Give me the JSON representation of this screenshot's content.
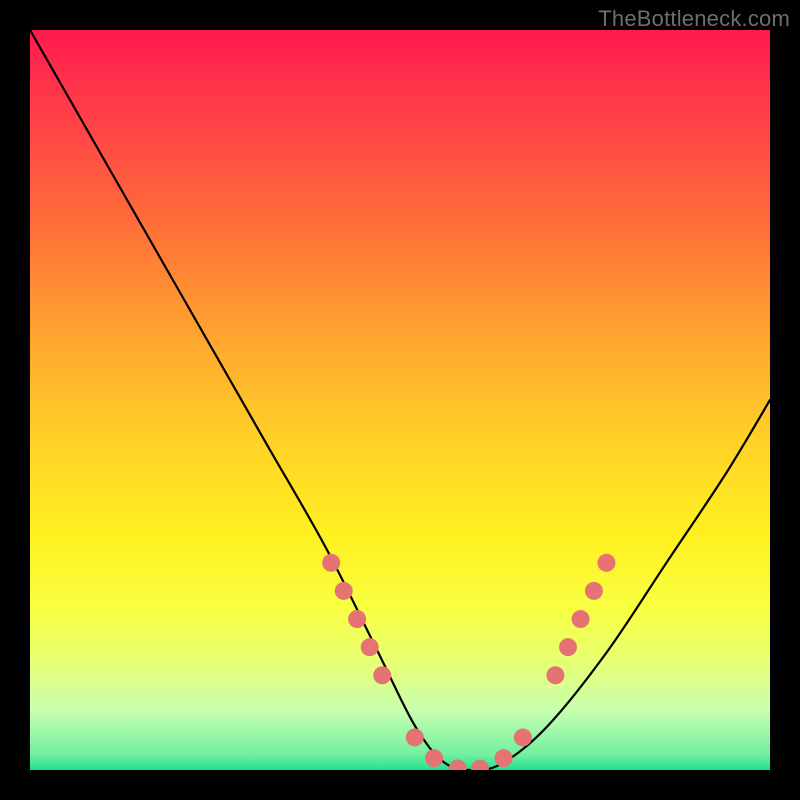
{
  "watermark": "TheBottleneck.com",
  "chart_data": {
    "type": "line",
    "title": "",
    "xlabel": "",
    "ylabel": "",
    "xlim": [
      0,
      100
    ],
    "ylim": [
      0,
      100
    ],
    "grid": false,
    "series": [
      {
        "name": "bottleneck-curve",
        "x": [
          0,
          8,
          16,
          24,
          32,
          40,
          47,
          52,
          56,
          60,
          64,
          70,
          78,
          86,
          94,
          100
        ],
        "values": [
          100,
          86,
          72,
          58,
          44,
          30,
          16,
          6,
          1,
          0,
          1,
          6,
          16,
          28,
          40,
          50
        ]
      }
    ],
    "markers": {
      "name": "highlighted-dots",
      "color": "#e57373",
      "radius": 9,
      "points_xy": [
        [
          40.7,
          28.0
        ],
        [
          42.4,
          24.2
        ],
        [
          44.2,
          20.4
        ],
        [
          45.9,
          16.6
        ],
        [
          47.6,
          12.8
        ],
        [
          52.0,
          4.4
        ],
        [
          54.6,
          1.6
        ],
        [
          57.8,
          0.2
        ],
        [
          60.8,
          0.2
        ],
        [
          64.0,
          1.6
        ],
        [
          66.6,
          4.4
        ],
        [
          71.0,
          12.8
        ],
        [
          72.7,
          16.6
        ],
        [
          74.4,
          20.4
        ],
        [
          76.2,
          24.2
        ],
        [
          77.9,
          28.0
        ]
      ]
    }
  }
}
